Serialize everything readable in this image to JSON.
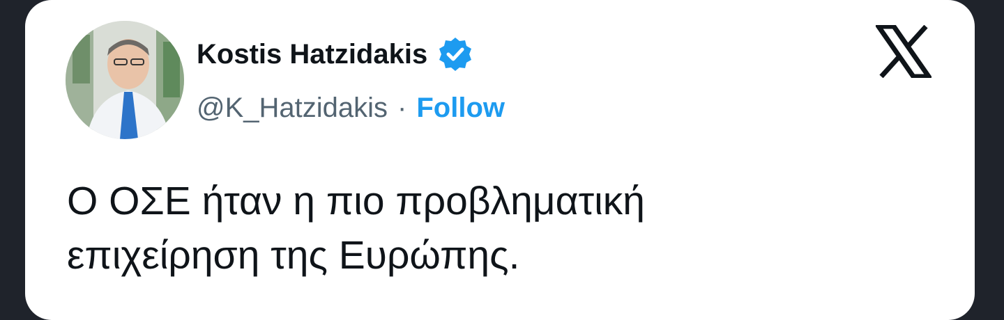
{
  "author": {
    "name": "Kostis Hatzidakis",
    "handle": "@K_Hatzidakis",
    "separator": "·",
    "follow_label": "Follow",
    "verified": true,
    "verified_icon": "verified-badge-icon",
    "avatar": "profile-photo"
  },
  "platform": {
    "logo": "x-logo-icon"
  },
  "tweet": {
    "lines": [
      "Ο ΟΣΕ ήταν η πιο προβληματική",
      "επιχείρηση της Ευρώπης."
    ]
  },
  "colors": {
    "accent": "#1d9bf0",
    "text": "#0f1419",
    "secondary_text": "#536471",
    "card_bg": "#ffffff",
    "frame_bg": "#1f232b"
  }
}
